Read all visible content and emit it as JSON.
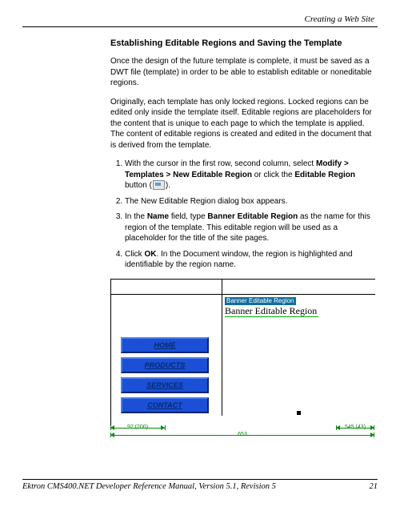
{
  "header": {
    "breadcrumb": "Creating a Web Site"
  },
  "section": {
    "title": "Establishing Editable Regions and Saving the Template",
    "para1": "Once the design of the future template is complete, it must be saved as a DWT file (template) in order to be able to establish editable or noneditable regions.",
    "para2": "Originally, each template has only locked regions. Locked regions can be edited only inside the template itself. Editable regions are placeholders for the content that is unique to each page to which the template is applied. The content of editable regions is created and edited in the document that is derived from the template."
  },
  "steps": {
    "s1_a": "With the cursor in the first row, second column, select ",
    "s1_b": "Modify > Templates > New Editable Region",
    "s1_c": " or click the ",
    "s1_d": "Editable Region",
    "s1_e": " button (",
    "s1_f": ").",
    "s2": "The New Editable Region dialog box appears.",
    "s3_a": "In the ",
    "s3_b": "Name",
    "s3_c": " field, type ",
    "s3_d": "Banner Editable Region",
    "s3_e": " as the name for this region of the template. This editable region will be used as a placeholder for the title of the site pages.",
    "s4_a": "Click ",
    "s4_b": "OK",
    "s4_c": ". In the Document window, the region is highlighted and identifiable by the region name."
  },
  "figure": {
    "region_label": "Banner Editable Region",
    "region_text": "Banner Editable Region",
    "nav": [
      "HOME",
      "PRODUCTS",
      "SERVICES",
      "CONTACT"
    ],
    "ruler": {
      "seg_a": "92 (200)",
      "seg_b": "545 (43)",
      "seg_c": "653"
    }
  },
  "footer": {
    "manual": "Ektron CMS400.NET Developer Reference Manual, Version 5.1, Revision 5",
    "page": "21"
  }
}
